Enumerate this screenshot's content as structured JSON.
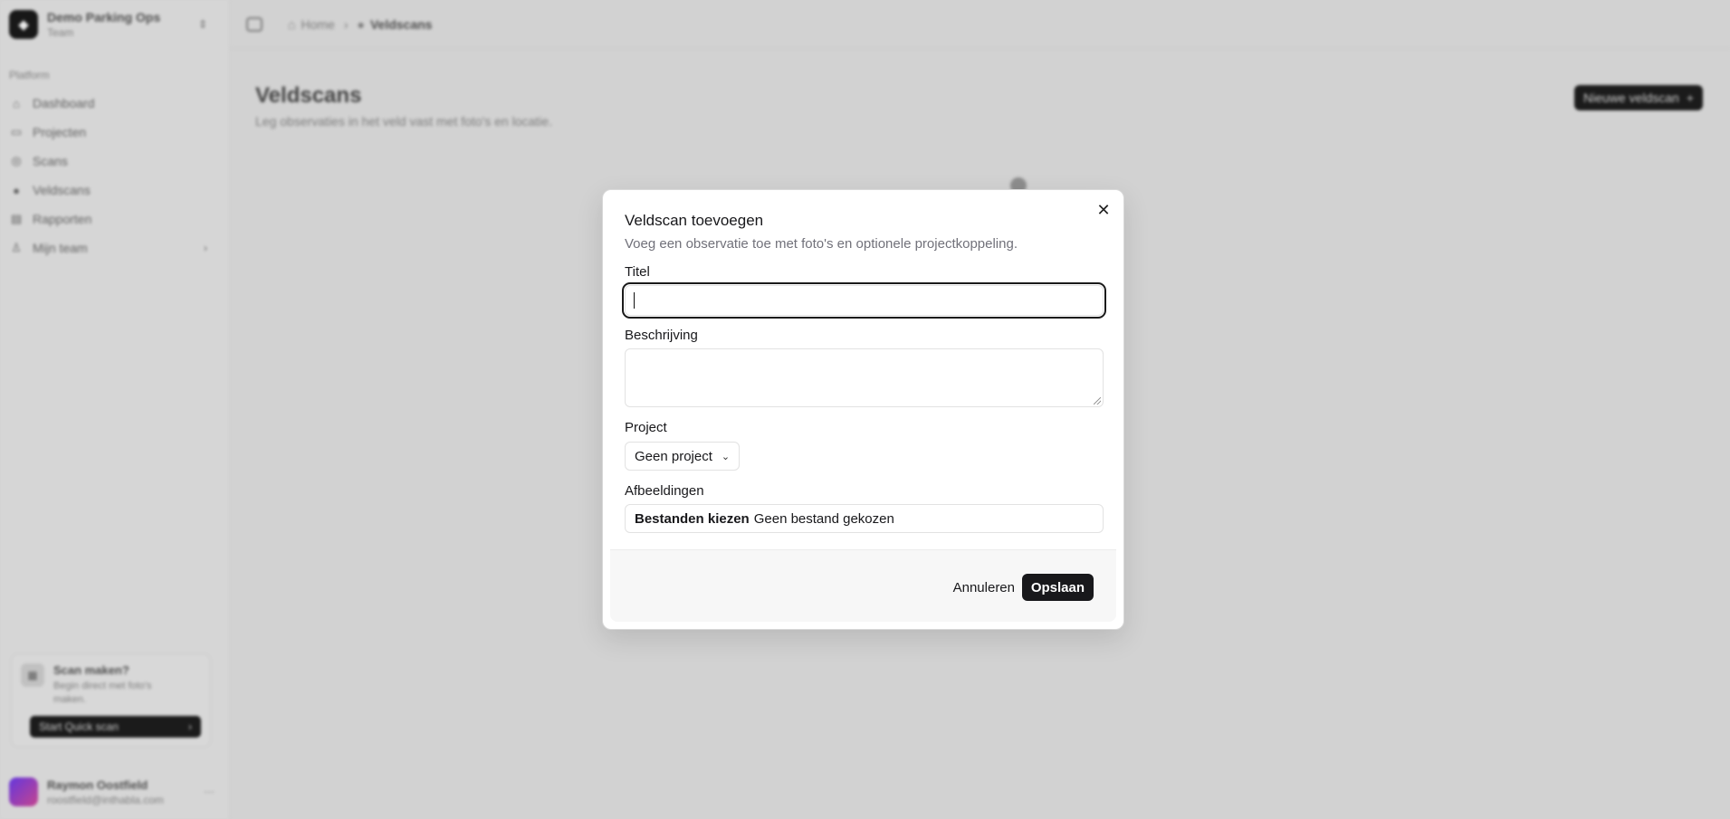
{
  "sidebar": {
    "team_name": "Demo Parking Ops",
    "team_role": "Team",
    "group_label": "Platform",
    "items": [
      {
        "label": "Dashboard",
        "icon": "home-icon"
      },
      {
        "label": "Projecten",
        "icon": "folder-icon"
      },
      {
        "label": "Scans",
        "icon": "scan-icon"
      },
      {
        "label": "Veldscans",
        "icon": "camera-icon"
      },
      {
        "label": "Rapporten",
        "icon": "file-icon"
      },
      {
        "label": "Mijn team",
        "icon": "user-icon"
      }
    ],
    "promo": {
      "title": "Scan maken?",
      "subtitle": "Begin direct met foto's maken.",
      "button": "Start Quick scan"
    },
    "user": {
      "name": "Raymon Oostfield",
      "email": "roostfield@inthabla.com"
    }
  },
  "breadcrumb": {
    "home": "Home",
    "current": "Veldscans"
  },
  "page": {
    "title": "Veldscans",
    "subtitle": "Leg observaties in het veld vast met foto's en locatie.",
    "new_button": "Nieuwe veldscan"
  },
  "dialog": {
    "title": "Veldscan toevoegen",
    "description": "Voeg een observatie toe met foto's en optionele projectkoppeling.",
    "fields": {
      "title_label": "Titel",
      "title_value": "",
      "description_label": "Beschrijving",
      "description_value": "",
      "project_label": "Project",
      "project_value": "Geen project",
      "images_label": "Afbeeldingen",
      "file_button": "Bestanden kiezen",
      "file_status": "Geen bestand gekozen"
    },
    "cancel": "Annuleren",
    "save": "Opslaan"
  }
}
